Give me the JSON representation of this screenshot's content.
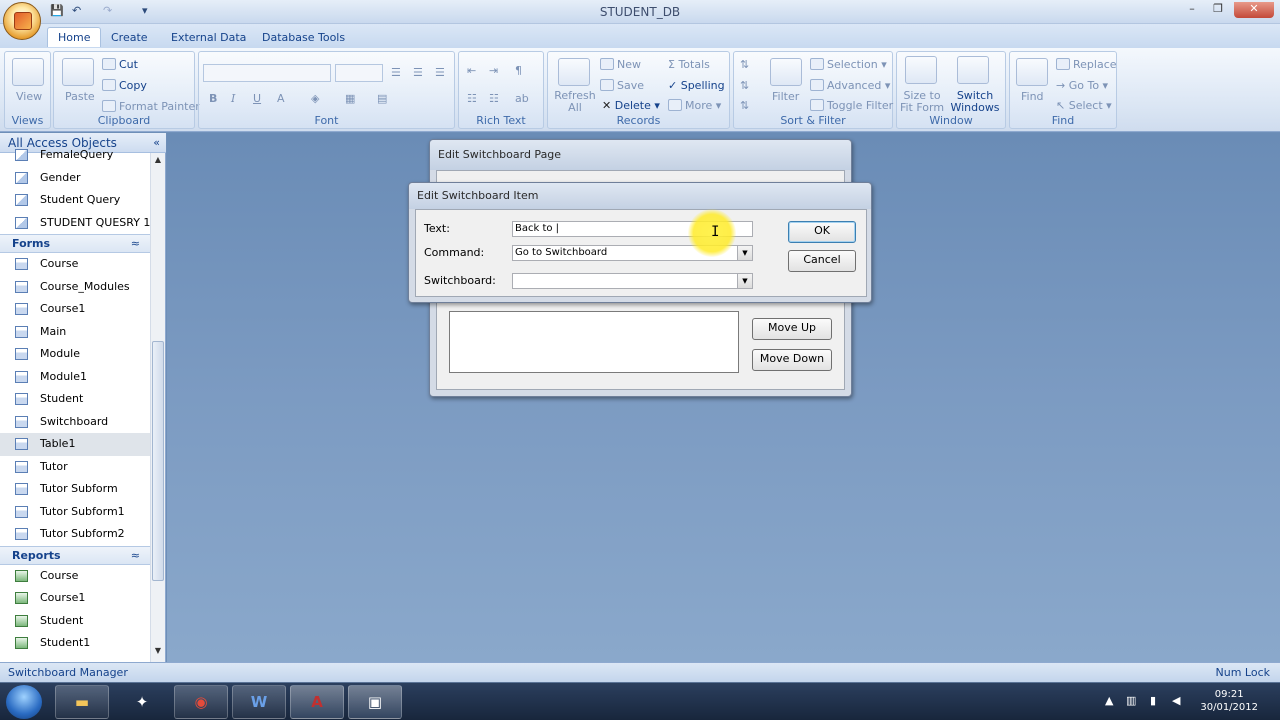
{
  "window": {
    "title": "STUDENT_DB",
    "min": "–",
    "max": "❐",
    "close": "✕"
  },
  "qat": {
    "save": "💾",
    "undo": "↶",
    "redo": "↷",
    "more": "▾"
  },
  "tabs": [
    "Home",
    "Create",
    "External Data",
    "Database Tools"
  ],
  "ribbon": {
    "views": {
      "label": "Views",
      "view": "View"
    },
    "clipboard": {
      "label": "Clipboard",
      "paste": "Paste",
      "cut": "Cut",
      "copy": "Copy",
      "format_painter": "Format Painter"
    },
    "font": {
      "label": "Font",
      "bold": "B",
      "italic": "I",
      "underline": "U",
      "font_color": "A"
    },
    "rich_text": {
      "label": "Rich Text"
    },
    "records": {
      "label": "Records",
      "refresh": "Refresh All",
      "new": "New",
      "save": "Save",
      "delete": "Delete",
      "totals": "Totals",
      "spelling": "Spelling",
      "more": "More"
    },
    "sort_filter": {
      "label": "Sort & Filter",
      "filter": "Filter",
      "selection": "Selection",
      "advanced": "Advanced",
      "toggle_filter": "Toggle Filter"
    },
    "window": {
      "label": "Window",
      "size_to_fit": "Size to Fit Form",
      "switch_windows": "Switch Windows"
    },
    "find": {
      "label": "Find",
      "find": "Find",
      "replace": "Replace",
      "goto": "Go To",
      "select": "Select"
    }
  },
  "nav": {
    "header": "All Access Objects",
    "collapse": "«",
    "queries": [
      "FemaleQuery",
      "Gender",
      "Student Query",
      "STUDENT QUESRY 1"
    ],
    "forms_header": "Forms",
    "forms": [
      "Course",
      "Course_Modules",
      "Course1",
      "Main",
      "Module",
      "Module1",
      "Student",
      "Switchboard",
      "Table1",
      "Tutor",
      "Tutor Subform",
      "Tutor Subform1",
      "Tutor Subform2"
    ],
    "selected": "Table1",
    "reports_header": "Reports",
    "reports": [
      "Course",
      "Course1",
      "Student",
      "Student1"
    ],
    "chevron": "≈"
  },
  "dialog_page": {
    "title": "Edit Switchboard Page",
    "move_up": "Move Up",
    "move_down": "Move Down"
  },
  "dialog_item": {
    "title": "Edit Switchboard Item",
    "text_label": "Text:",
    "text_value": "Back to |",
    "command_label": "Command:",
    "command_value": "Go to Switchboard",
    "switchboard_label": "Switchboard:",
    "switchboard_value": "",
    "ok": "OK",
    "cancel": "Cancel"
  },
  "status": {
    "left": "Switchboard Manager",
    "right": "Num Lock"
  },
  "taskbar": {
    "time": "09:21",
    "date": "30/01/2012"
  }
}
